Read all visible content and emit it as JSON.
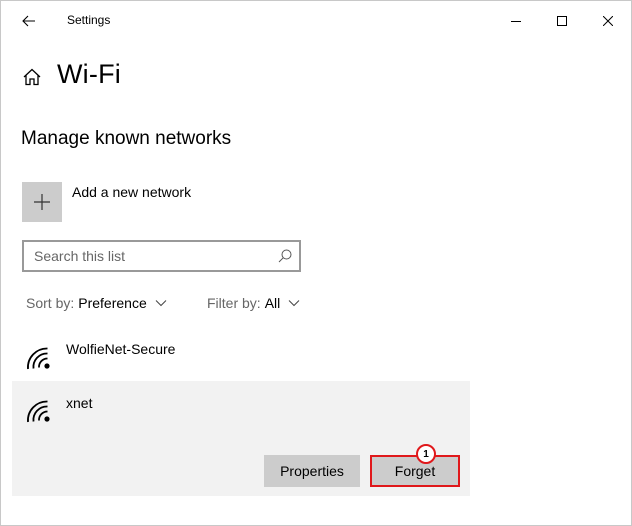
{
  "titlebar": {
    "title": "Settings",
    "back_icon": "arrow-left-icon",
    "minimize_icon": "minimize-icon",
    "maximize_icon": "maximize-icon",
    "close_icon": "close-icon"
  },
  "header": {
    "home_icon": "home-icon",
    "title": "Wi-Fi"
  },
  "section": {
    "title": "Manage known networks"
  },
  "add_network": {
    "icon": "plus-icon",
    "label": "Add a new network"
  },
  "search": {
    "placeholder": "Search this list",
    "value": "",
    "icon": "search-icon"
  },
  "sort": {
    "label": "Sort by:",
    "value": "Preference"
  },
  "filter": {
    "label": "Filter by:",
    "value": "All"
  },
  "networks": [
    {
      "name": "WolfieNet-Secure",
      "icon": "wifi-icon",
      "selected": false
    },
    {
      "name": "xnet",
      "icon": "wifi-icon",
      "selected": true
    }
  ],
  "actions": {
    "properties_label": "Properties",
    "forget_label": "Forget"
  },
  "annotation": {
    "step": "1",
    "highlight_color": "#e0181b"
  }
}
